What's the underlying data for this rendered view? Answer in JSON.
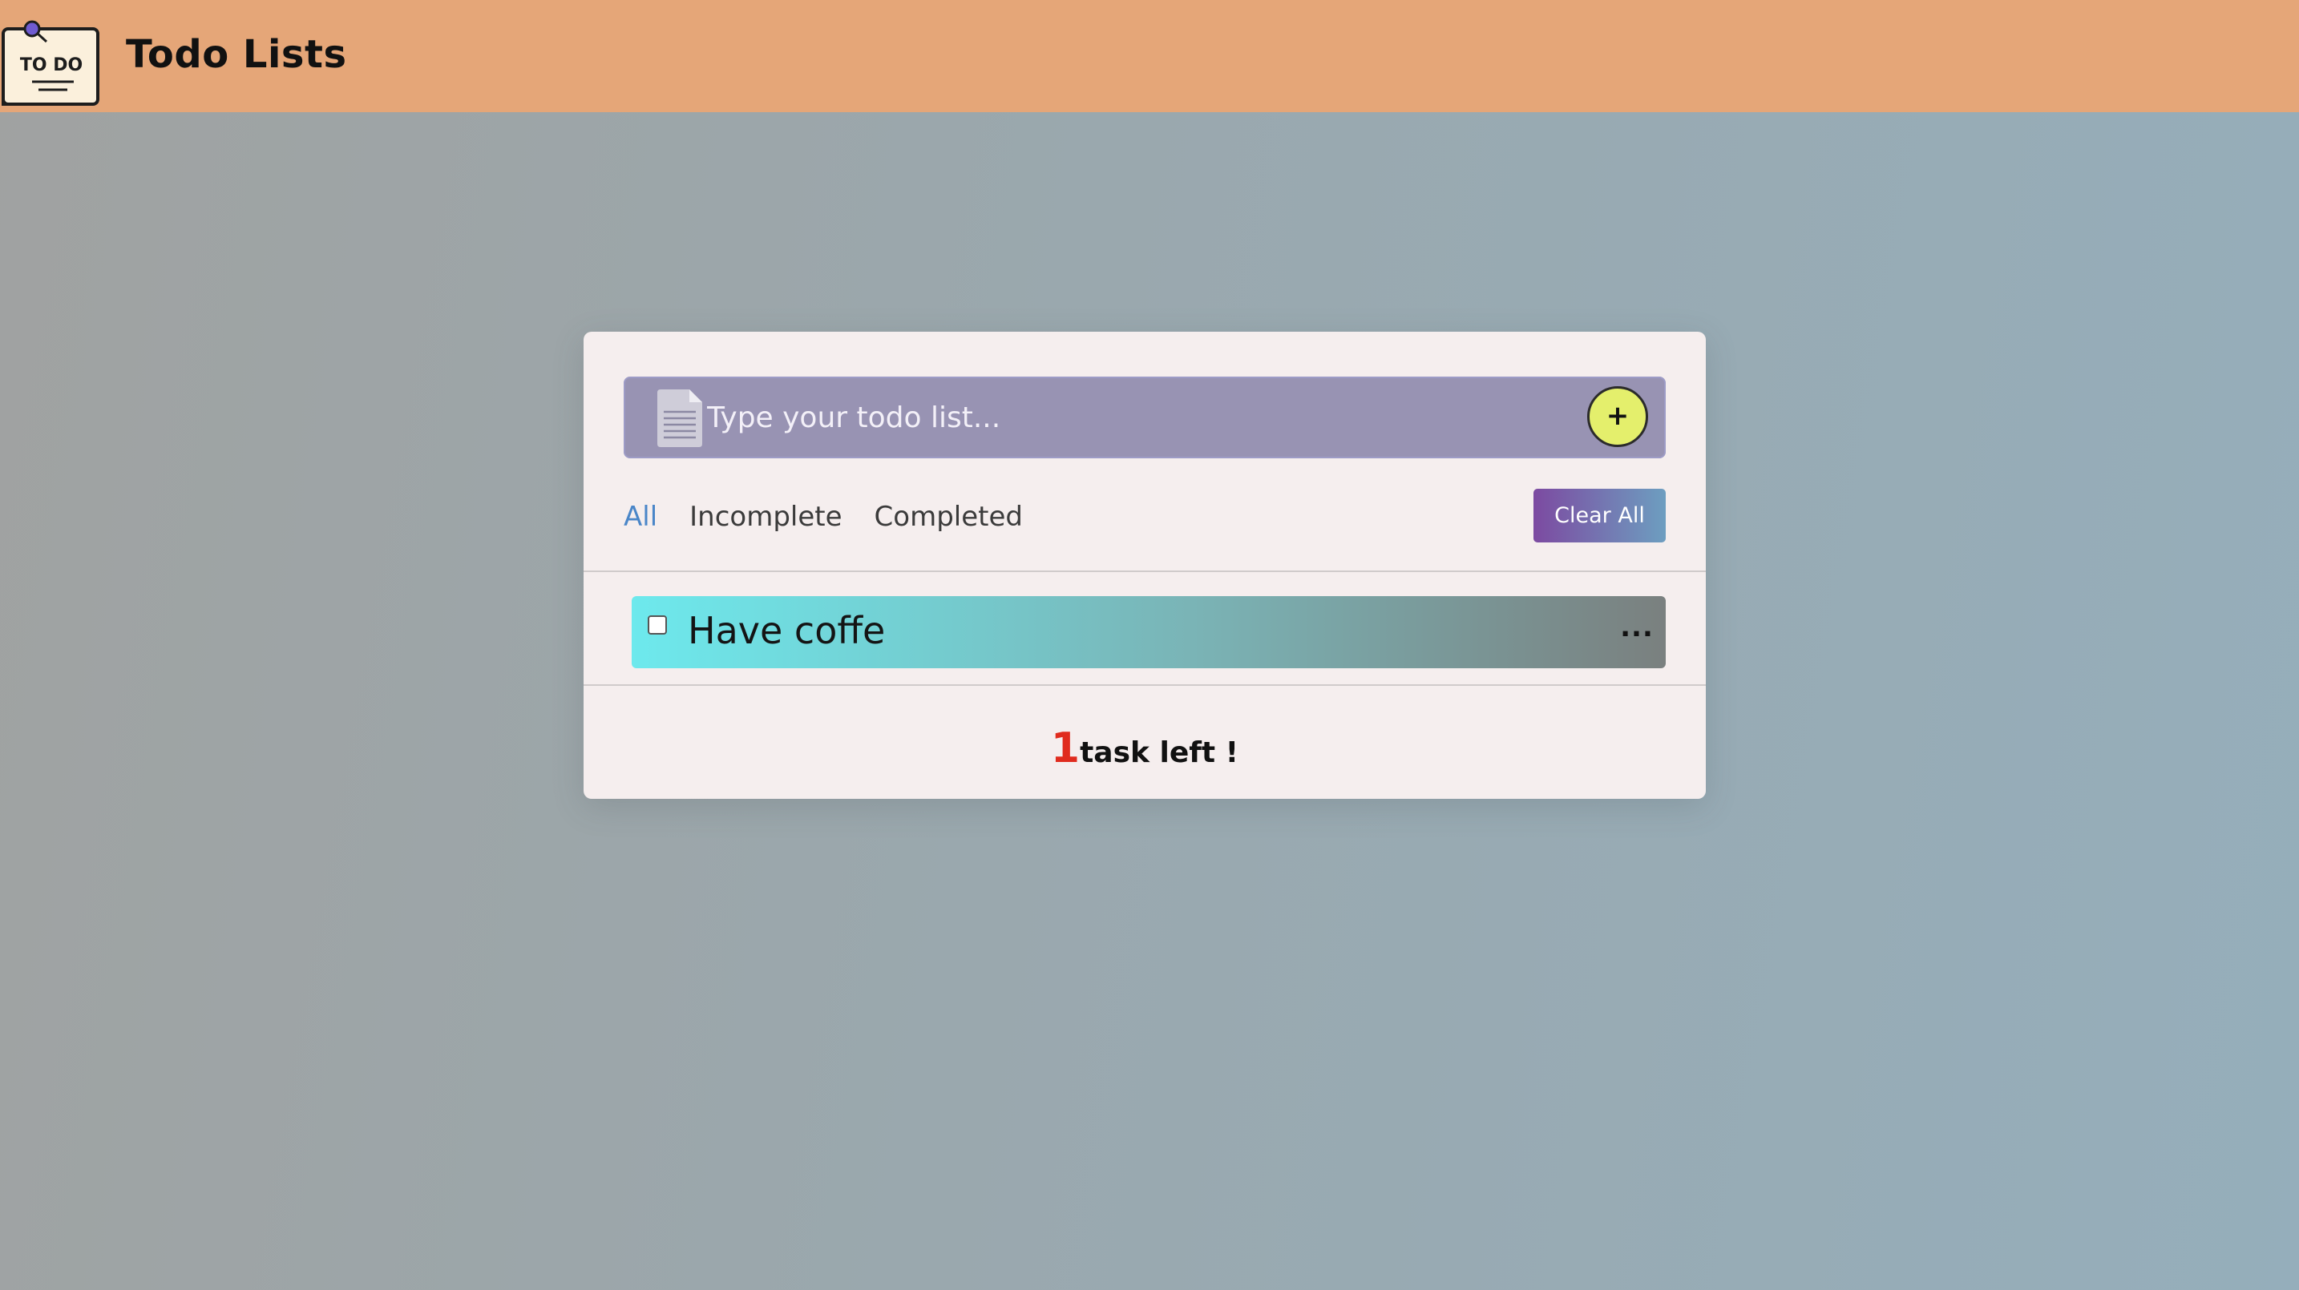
{
  "header": {
    "logo_text": "TO DO",
    "title": "Todo Lists"
  },
  "input": {
    "placeholder": "Type your todo list...",
    "add_label": "+"
  },
  "filters": {
    "tabs": [
      {
        "label": "All",
        "active": true
      },
      {
        "label": "Incomplete",
        "active": false
      },
      {
        "label": "Completed",
        "active": false
      }
    ],
    "clear_label": "Clear All"
  },
  "tasks": [
    {
      "text": "Have coffe",
      "checked": false,
      "menu_label": "..."
    }
  ],
  "footer": {
    "count": "1",
    "label": "task left !"
  },
  "colors": {
    "header_bg": "#e5a678",
    "accent_tab": "#4a86c8",
    "add_button": "#e4ef6c",
    "count_red": "#e02b1e"
  },
  "icons": {
    "logo": "todo-note-logo",
    "input": "document-icon",
    "add": "plus-icon",
    "menu": "more-horizontal-icon"
  }
}
